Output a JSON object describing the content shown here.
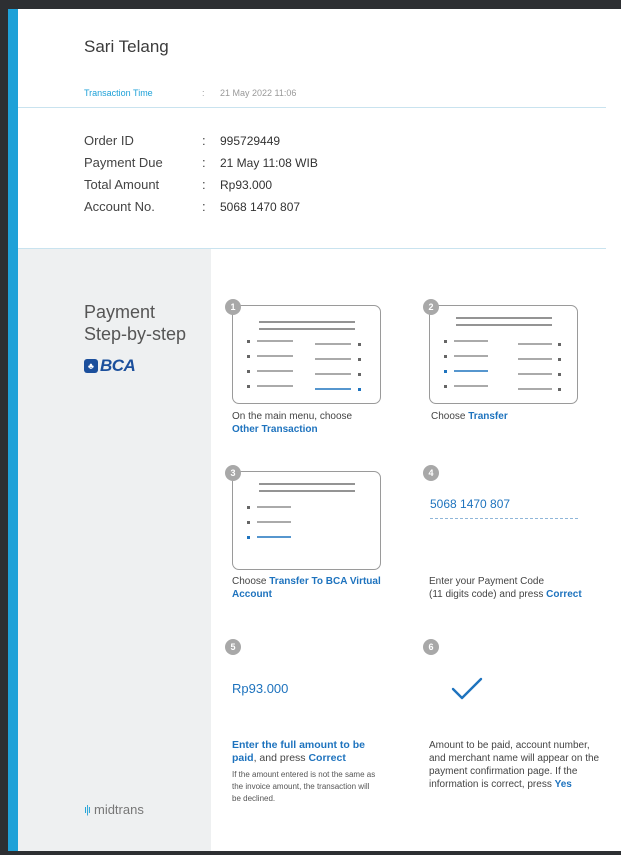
{
  "receipt": {
    "customer_name": "Sari Telang",
    "transaction_time": {
      "label": "Transaction Time",
      "separator": ":",
      "value": "21 May 2022 11:06"
    },
    "details": [
      {
        "label": "Order ID",
        "separator": ":",
        "value": "995729449"
      },
      {
        "label": "Payment Due",
        "separator": ":",
        "value": "21 May 11:08 WIB"
      },
      {
        "label": "Total Amount",
        "separator": ":",
        "value": "Rp93.000"
      },
      {
        "label": "Account No.",
        "separator": ":",
        "value": "5068 1470 807"
      }
    ]
  },
  "sidebar": {
    "title_line1": "Payment",
    "title_line2": "Step-by-step",
    "bank_logo_text": "BCA",
    "footer_logo_text": "midtrans"
  },
  "steps": [
    {
      "number": "1",
      "text_before": "On the main menu, choose",
      "highlight": "Other Transaction"
    },
    {
      "number": "2",
      "text_before": "Choose",
      "highlight": "Transfer"
    },
    {
      "number": "3",
      "text_before": "Choose",
      "highlight": "Transfer To BCA Virtual Account"
    },
    {
      "number": "4",
      "code": "5068 1470 807",
      "text_line1": "Enter your Payment Code",
      "text_line2": "(11 digits code) and press",
      "highlight": "Correct"
    },
    {
      "number": "5",
      "amount": "Rp93.000",
      "highlight_main": "Enter the full amount to be paid",
      "text_middle": ", and press",
      "highlight_action": "Correct",
      "note": "If the amount entered is not the same as the invoice amount, the transaction will be declined."
    },
    {
      "number": "6",
      "text_before": "Amount to be paid, account number, and merchant name will appear on the payment confirmation page. If the information is correct, press",
      "highlight": "Yes"
    }
  ],
  "colors": {
    "accent": "#1ea1d8",
    "highlight": "#1e73be",
    "bca": "#1b4f9c"
  },
  "icons": [
    "bca-logo-icon",
    "midtrans-logo-icon",
    "checkmark-icon"
  ]
}
